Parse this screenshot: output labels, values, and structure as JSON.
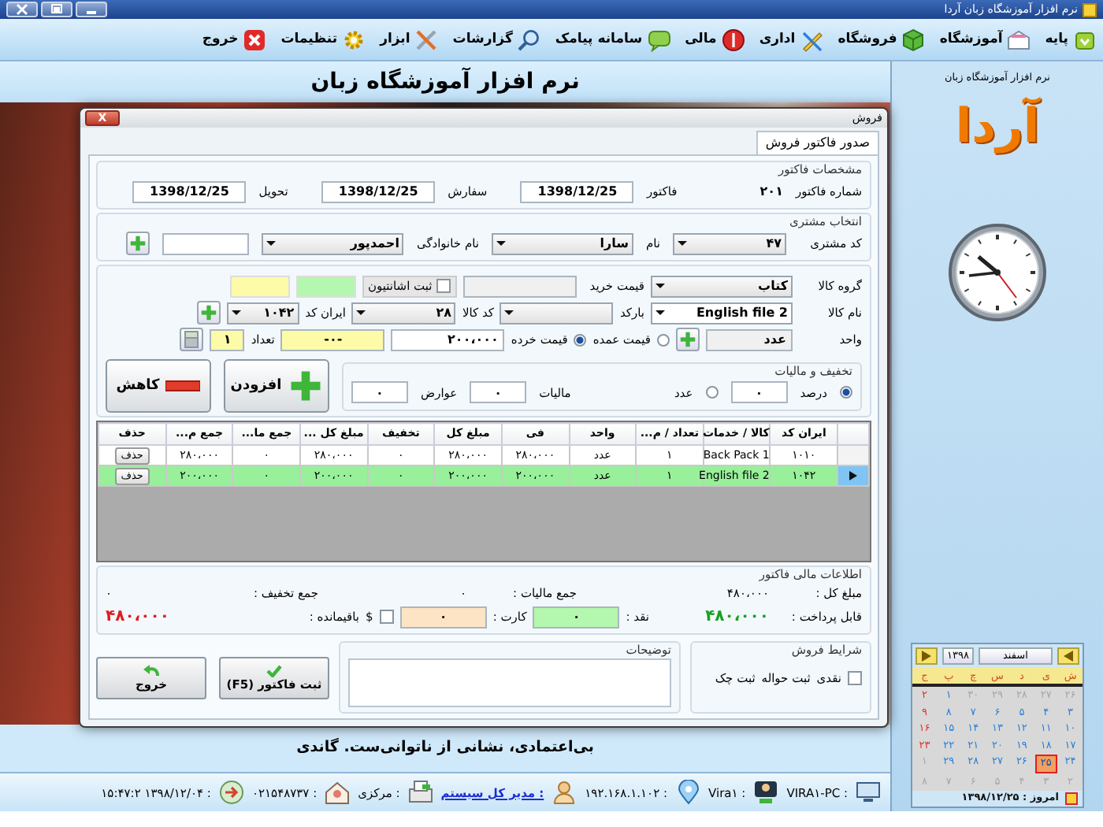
{
  "window": {
    "title": "نرم افزار آموزشگاه زبان آردا"
  },
  "menu": [
    "پایه",
    "آموزشگاه",
    "فروشگاه",
    "اداری",
    "مالی",
    "سامانه پیامک",
    "گزارشات",
    "ابزار",
    "تنظیمات",
    "خروج"
  ],
  "heading": "نرم افزار آموزشگاه زبان",
  "dialog": {
    "title": "فروش",
    "close": "X",
    "tabs": [
      {
        "label": "صدور فاکتور فروش",
        "selected": true
      }
    ],
    "invoice": {
      "legend": "مشخصات فاکتور",
      "number_label": "شماره فاکتور",
      "number": "۲۰۱",
      "invoice_date_label": "فاکتور",
      "invoice_date": "1398/12/25",
      "order_label": "سفارش",
      "order_date": "1398/12/25",
      "delivery_label": "تحویل",
      "delivery_date": "1398/12/25"
    },
    "customer": {
      "legend": "انتخاب مشتری",
      "code_label": "کد مشتری",
      "code": "۴۷",
      "name_label": "نام",
      "name": "سارا",
      "family_label": "نام خانوادگی",
      "family": "احمدپور"
    },
    "product": {
      "group_label": "گروه کالا",
      "group": "کتاب",
      "buy_price_label": "قیمت خرید",
      "gift_label": "ثبت اشانتیون",
      "gift_checked": false,
      "name_label": "نام کالا",
      "name": "English file 2",
      "barcode_label": "بارکد",
      "code_label": "کد کالا",
      "code": "۲۸",
      "iran_code_label": "ایران کد",
      "iran_code": "۱۰۴۲",
      "unit_label": "واحد",
      "unit": "عدد",
      "price_types": [
        {
          "label": "قیمت عمده",
          "selected": false
        },
        {
          "label": "قیمت خرده",
          "selected": true
        }
      ],
      "price": "۲۰۰،۰۰۰",
      "discount_display": "-۰-",
      "qty_label": "تعداد",
      "qty": "۱"
    },
    "tax": {
      "legend": "تخفیف و مالیات",
      "modes": [
        {
          "label": "درصد",
          "selected": true
        },
        {
          "label": "عدد",
          "selected": false
        }
      ],
      "discount": "۰",
      "tax_label": "مالیات",
      "tax": "۰",
      "duty_label": "عوارض",
      "duty": "۰"
    },
    "add_button": "افزودن",
    "reduce_button": "کاهش",
    "table": {
      "columns": [
        "ایران کد",
        "کالا / خدمات",
        "تعداد / م...",
        "واحد",
        "فی",
        "مبلغ کل",
        "تخفیف",
        "مبلغ کل ...",
        "جمع ما...",
        "جمع م...",
        "حذف"
      ],
      "rows": [
        {
          "selected": false,
          "cells": [
            "۱۰۱۰",
            "Back Pack 1",
            "۱",
            "عدد",
            "۲۸۰،۰۰۰",
            "۲۸۰،۰۰۰",
            "۰",
            "۲۸۰،۰۰۰",
            "۰",
            "۲۸۰،۰۰۰",
            "حذف"
          ]
        },
        {
          "selected": true,
          "cells": [
            "۱۰۴۲",
            "English file 2",
            "۱",
            "عدد",
            "۲۰۰،۰۰۰",
            "۲۰۰،۰۰۰",
            "۰",
            "۲۰۰،۰۰۰",
            "۰",
            "۲۰۰،۰۰۰",
            "حذف"
          ]
        }
      ]
    },
    "finance": {
      "legend": "اطلاعات مالی فاکتور",
      "total_label": "مبلغ کل :",
      "total": "۴۸۰،۰۰۰",
      "tax_sum_label": "جمع مالیات :",
      "tax_sum": "۰",
      "discount_sum_label": "جمع تخفیف :",
      "discount_sum": "۰",
      "payable_label": "قابل پرداخت :",
      "payable": "۴۸۰،۰۰۰",
      "cash_label": "نقد :",
      "cash": "۰",
      "card_label": "کارت :",
      "card": "۰",
      "currency_label": "$",
      "currency_checked": false,
      "remaining_label": "باقیمانده :",
      "remaining": "۴۸۰،۰۰۰"
    },
    "terms": {
      "legend": "شرایط فروش",
      "cash_label": "نقدی",
      "cash_checked": false,
      "links": [
        "ثبت حواله",
        "ثبت چک"
      ]
    },
    "notes_label": "توضیحات",
    "submit_button": "ثبت فاکتور (F5)",
    "exit_button": "خروج"
  },
  "quote": "بی‌اعتمادی، نشانی از ناتوانی‌ست. گاندی",
  "status_bar": [
    {
      "kind": "text",
      "text": ": VIRA۱-PC"
    },
    {
      "kind": "text",
      "text": ": Vira۱"
    },
    {
      "kind": "text",
      "text": ": ۱۹۲.۱۶۸.۱.۱۰۲"
    },
    {
      "kind": "link",
      "text": ": مدیر کل سیستم"
    },
    {
      "kind": "text",
      "text": ": مرکزی"
    },
    {
      "kind": "text",
      "text": ": ۰۲۱۵۴۸۷۳۷"
    },
    {
      "kind": "text",
      "text": ": ۱۳۹۸/۱۲/۰۴ ۱۵:۴۷:۲"
    }
  ],
  "sidebar": {
    "title": "نرم افزار آموزشگاه زبان",
    "logo": "آردا",
    "calendar": {
      "month": "اسفند",
      "year": "۱۳۹۸",
      "weekdays": [
        "ش",
        "ی",
        "د",
        "س",
        "چ",
        "پ",
        "ج"
      ],
      "weeks": [
        [
          {
            "d": "۲۶",
            "kind": "other",
            "selected": false
          },
          {
            "d": "۲۷",
            "kind": "other",
            "selected": false
          },
          {
            "d": "۲۸",
            "kind": "other",
            "selected": false
          },
          {
            "d": "۲۹",
            "kind": "other",
            "selected": false
          },
          {
            "d": "۳۰",
            "kind": "other",
            "selected": false
          },
          {
            "d": "۱",
            "kind": "current",
            "selected": false
          },
          {
            "d": "۲",
            "kind": "current",
            "selected": false
          }
        ],
        [
          {
            "d": "۳",
            "kind": "current",
            "selected": false
          },
          {
            "d": "۴",
            "kind": "current",
            "selected": false
          },
          {
            "d": "۵",
            "kind": "current",
            "selected": false
          },
          {
            "d": "۶",
            "kind": "current",
            "selected": false
          },
          {
            "d": "۷",
            "kind": "current",
            "selected": false
          },
          {
            "d": "۸",
            "kind": "current",
            "selected": false
          },
          {
            "d": "۹",
            "kind": "current",
            "selected": false
          }
        ],
        [
          {
            "d": "۱۰",
            "kind": "current",
            "selected": false
          },
          {
            "d": "۱۱",
            "kind": "current",
            "selected": false
          },
          {
            "d": "۱۲",
            "kind": "current",
            "selected": false
          },
          {
            "d": "۱۳",
            "kind": "current",
            "selected": false
          },
          {
            "d": "۱۴",
            "kind": "current",
            "selected": false
          },
          {
            "d": "۱۵",
            "kind": "current",
            "selected": false
          },
          {
            "d": "۱۶",
            "kind": "current",
            "selected": false
          }
        ],
        [
          {
            "d": "۱۷",
            "kind": "current",
            "selected": false
          },
          {
            "d": "۱۸",
            "kind": "current",
            "selected": false
          },
          {
            "d": "۱۹",
            "kind": "current",
            "selected": false
          },
          {
            "d": "۲۰",
            "kind": "current",
            "selected": false
          },
          {
            "d": "۲۱",
            "kind": "current",
            "selected": false
          },
          {
            "d": "۲۲",
            "kind": "current",
            "selected": false
          },
          {
            "d": "۲۳",
            "kind": "current",
            "selected": false
          }
        ],
        [
          {
            "d": "۲۴",
            "kind": "current",
            "selected": false
          },
          {
            "d": "۲۵",
            "kind": "current",
            "selected": true
          },
          {
            "d": "۲۶",
            "kind": "current",
            "selected": false
          },
          {
            "d": "۲۷",
            "kind": "current",
            "selected": false
          },
          {
            "d": "۲۸",
            "kind": "current",
            "selected": false
          },
          {
            "d": "۲۹",
            "kind": "current",
            "selected": false
          },
          {
            "d": "۱",
            "kind": "other",
            "selected": false
          }
        ],
        [
          {
            "d": "۲",
            "kind": "other",
            "selected": false
          },
          {
            "d": "۳",
            "kind": "other",
            "selected": false
          },
          {
            "d": "۴",
            "kind": "other",
            "selected": false
          },
          {
            "d": "۵",
            "kind": "other",
            "selected": false
          },
          {
            "d": "۶",
            "kind": "other",
            "selected": false
          },
          {
            "d": "۷",
            "kind": "other",
            "selected": false
          },
          {
            "d": "۸",
            "kind": "other",
            "selected": false
          }
        ]
      ],
      "today": "امروز : ۱۳۹۸/۱۲/۲۵"
    }
  }
}
